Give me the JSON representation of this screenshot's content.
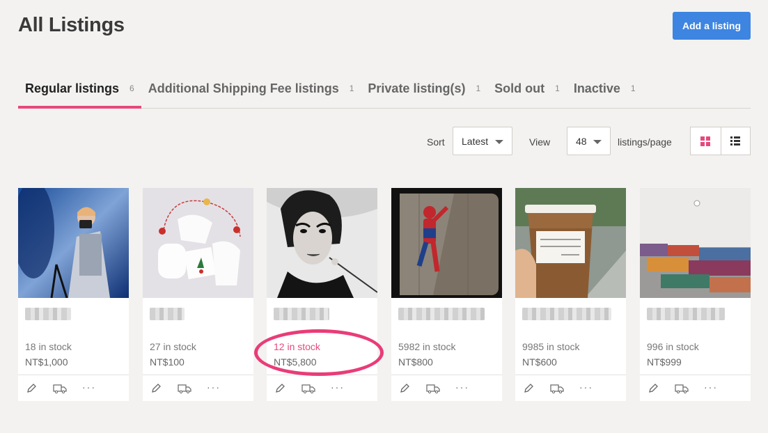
{
  "page": {
    "title": "All Listings"
  },
  "header": {
    "add_button_label": "Add a listing"
  },
  "tabs": [
    {
      "label": "Regular listings",
      "count": "6",
      "active": true
    },
    {
      "label": "Additional Shipping Fee listings",
      "count": "1",
      "active": false
    },
    {
      "label": "Private listing(s)",
      "count": "1",
      "active": false
    },
    {
      "label": "Sold out",
      "count": "1",
      "active": false
    },
    {
      "label": "Inactive",
      "count": "1",
      "active": false
    }
  ],
  "toolbar": {
    "sort_label": "Sort",
    "sort_value": "Latest",
    "view_label": "View",
    "per_page_value": "48",
    "per_page_suffix": "listings/page",
    "view_modes": [
      {
        "icon": "grid-icon",
        "active": true,
        "color": "#e6497c"
      },
      {
        "icon": "list-icon",
        "active": false,
        "color": "#333333"
      }
    ]
  },
  "listings": [
    {
      "stock": "18 in stock",
      "price": "NT$1,000",
      "image": "photographer-photo"
    },
    {
      "stock": "27 in stock",
      "price": "NT$100",
      "image": "paper-ornaments-photo"
    },
    {
      "stock": "12 in stock",
      "price": "NT$5,800",
      "image": "portrait-photo",
      "highlighted": true
    },
    {
      "stock": "5982 in stock",
      "price": "NT$800",
      "image": "spiderman-figure-photo"
    },
    {
      "stock": "9985 in stock",
      "price": "NT$600",
      "image": "coffee-cup-photo"
    },
    {
      "stock": "996 in stock",
      "price": "NT$999",
      "image": "sleeping-bags-photo"
    }
  ],
  "card_actions": {
    "edit_icon": "pencil-icon",
    "ship_icon": "truck-icon",
    "more_label": "···"
  },
  "colors": {
    "accent": "#e6497c",
    "primary": "#3d85e0",
    "annotation": "#e93c78"
  }
}
